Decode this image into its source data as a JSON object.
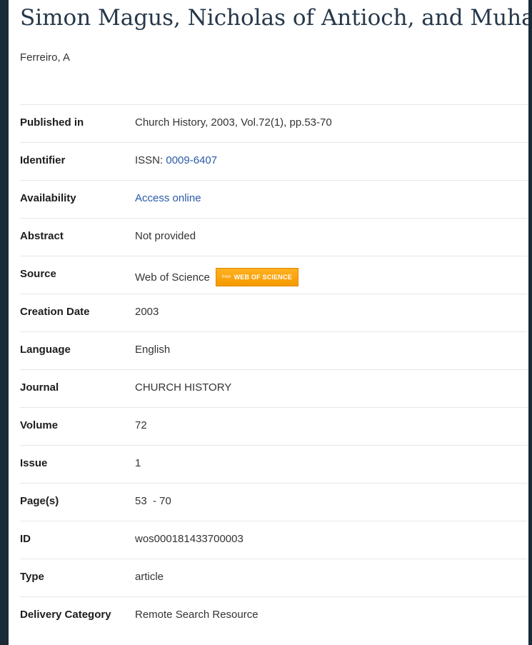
{
  "record": {
    "title": "Simon Magus, Nicholas of Antioch, and Muhammad",
    "author": "Ferreiro, A"
  },
  "details": {
    "published_in": {
      "label": "Published in",
      "value": "Church History, 2003, Vol.72(1), pp.53-70"
    },
    "identifier": {
      "label": "Identifier",
      "prefix": "ISSN: ",
      "value": "0009-6407"
    },
    "availability": {
      "label": "Availability",
      "value": "Access online"
    },
    "abstract": {
      "label": "Abstract",
      "value": "Not provided"
    },
    "source": {
      "label": "Source",
      "value": "Web of Science",
      "badge_from": "from",
      "badge_text": "WEB OF SCIENCE"
    },
    "creation_date": {
      "label": "Creation Date",
      "value": "2003"
    },
    "language": {
      "label": "Language",
      "value": "English"
    },
    "journal": {
      "label": "Journal",
      "value": "CHURCH HISTORY"
    },
    "volume": {
      "label": "Volume",
      "value": "72"
    },
    "issue": {
      "label": "Issue",
      "value": "1"
    },
    "pages": {
      "label": "Page(s)",
      "value": "53  - 70"
    },
    "id": {
      "label": "ID",
      "value": "wos000181433700003"
    },
    "type": {
      "label": "Type",
      "value": "article"
    },
    "delivery_category": {
      "label": "Delivery Category",
      "value": "Remote Search Resource"
    }
  },
  "colors": {
    "link": "#2a5aa8",
    "title": "#26384a",
    "badge": "#f59a00",
    "frame": "#1b2a37"
  }
}
